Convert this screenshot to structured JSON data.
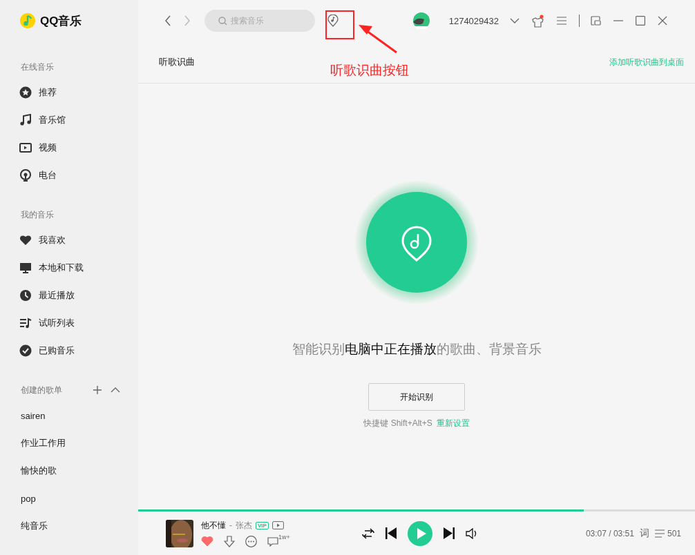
{
  "app": {
    "name": "QQ音乐"
  },
  "sidebar": {
    "sections": [
      {
        "title": "在线音乐",
        "kind": "icons",
        "items": [
          "推荐",
          "音乐馆",
          "视频",
          "电台"
        ]
      },
      {
        "title": "我的音乐",
        "kind": "icons",
        "items": [
          "我喜欢",
          "本地和下载",
          "最近播放",
          "试听列表",
          "已购音乐"
        ]
      },
      {
        "title": "创建的歌单",
        "kind": "playlists",
        "items": [
          "sairen",
          "作业工作用",
          "愉快的歌",
          "pop",
          "纯音乐"
        ]
      }
    ]
  },
  "header": {
    "search": {
      "placeholder": "搜索音乐"
    },
    "forward_disabled": true,
    "user": {
      "name": "1274029432"
    },
    "skin_notification": true
  },
  "page": {
    "title": "听歌识曲",
    "add_to_desktop": "添加听歌识曲到桌面",
    "description": "智能识别**电脑中正在播放**的歌曲、背景音乐",
    "start_button": "开始识别",
    "shortcut": "快捷键 Shift+Alt+S",
    "reset_link": "重新设置"
  },
  "annotation": {
    "text": "听歌识曲按钮"
  },
  "player": {
    "level": 0.8,
    "title": "他不懂",
    "separator": "-",
    "artist": "张杰",
    "badge": "VIP",
    "liked": true,
    "comment_count": "1w+",
    "playing": false,
    "time": "03:07 / 03:51",
    "lyrics": "词",
    "playlist_count": "501"
  }
}
